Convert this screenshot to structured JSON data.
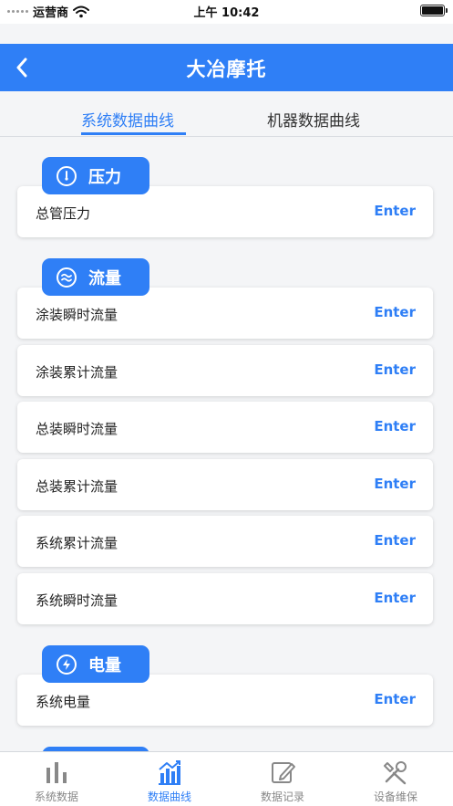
{
  "status_bar": {
    "carrier": "运营商",
    "time": "上午 10:42"
  },
  "nav": {
    "title": "大冶摩托"
  },
  "tabs": [
    {
      "label": "系统数据曲线",
      "active": true
    },
    {
      "label": "机器数据曲线",
      "active": false
    }
  ],
  "sections": [
    {
      "label": "压力",
      "icon": "gauge-icon",
      "items": [
        {
          "label": "总管压力",
          "action": "Enter"
        }
      ]
    },
    {
      "label": "流量",
      "icon": "flow-wave-icon",
      "items": [
        {
          "label": "涂装瞬时流量",
          "action": "Enter"
        },
        {
          "label": "涂装累计流量",
          "action": "Enter"
        },
        {
          "label": "总装瞬时流量",
          "action": "Enter"
        },
        {
          "label": "总装累计流量",
          "action": "Enter"
        },
        {
          "label": "系统累计流量",
          "action": "Enter"
        },
        {
          "label": "系统瞬时流量",
          "action": "Enter"
        }
      ]
    },
    {
      "label": "电量",
      "icon": "lightning-icon",
      "items": [
        {
          "label": "系统电量",
          "action": "Enter"
        }
      ]
    }
  ],
  "tabbar": [
    {
      "label": "系统数据",
      "icon": "bar-chart-icon",
      "active": false
    },
    {
      "label": "数据曲线",
      "icon": "curve-chart-icon",
      "active": true
    },
    {
      "label": "数据记录",
      "icon": "edit-record-icon",
      "active": false
    },
    {
      "label": "设备维保",
      "icon": "tools-icon",
      "active": false
    }
  ],
  "colors": {
    "primary": "#2f7ff6",
    "background": "#f4f5f7",
    "inactive": "#888888"
  }
}
